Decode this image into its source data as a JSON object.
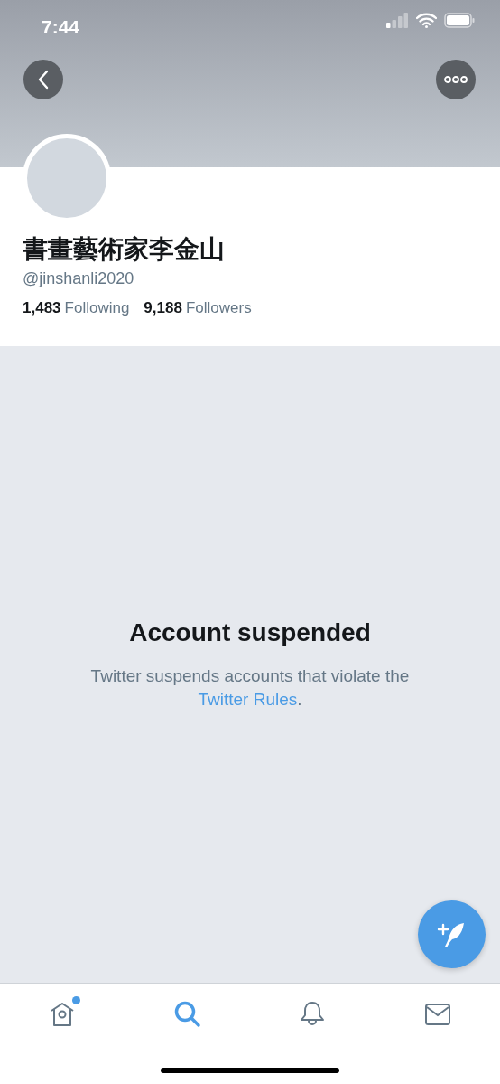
{
  "status_bar": {
    "time": "7:44"
  },
  "profile": {
    "name": "書畫藝術家李金山",
    "handle": "@jinshanli2020",
    "stats": [
      {
        "count": "1,483",
        "label": "Following"
      },
      {
        "count": "9,188",
        "label": "Followers"
      }
    ]
  },
  "notice": {
    "title": "Account suspended",
    "text": "Twitter suspends accounts that violate the ",
    "link": "Twitter Rules",
    "after": "."
  },
  "tabs": [
    {
      "kind": "home",
      "selected": false,
      "dot": true
    },
    {
      "kind": "search",
      "selected": true,
      "dot": false
    },
    {
      "kind": "notifications",
      "selected": false,
      "dot": false
    },
    {
      "kind": "messages",
      "selected": false,
      "dot": false
    }
  ]
}
